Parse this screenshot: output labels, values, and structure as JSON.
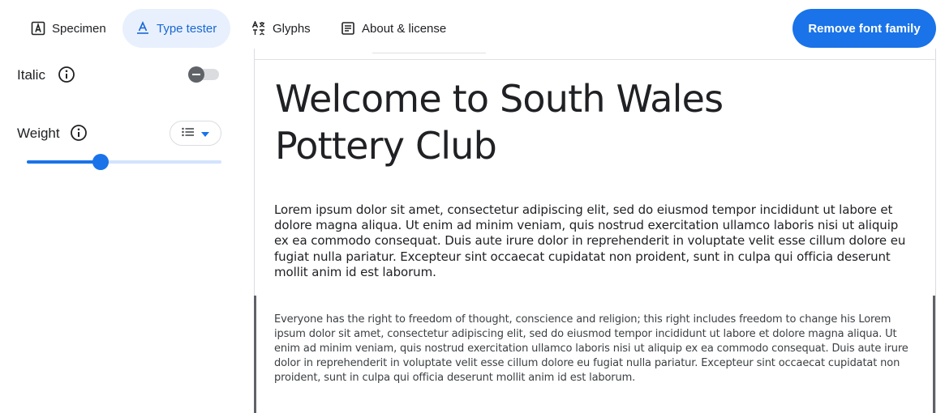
{
  "tabs": [
    {
      "label": "Specimen",
      "icon": "specimen-icon",
      "active": false
    },
    {
      "label": "Type tester",
      "icon": "type-tester-icon",
      "active": true
    },
    {
      "label": "Glyphs",
      "icon": "glyphs-icon",
      "active": false
    },
    {
      "label": "About & license",
      "icon": "article-icon",
      "active": false
    }
  ],
  "remove_button": "Remove font family",
  "controls": {
    "italic_label": "Italic",
    "italic_on": false,
    "weight_label": "Weight",
    "weight_fraction": 0.38
  },
  "preview": {
    "heading": "Welcome to South Wales Pottery Club",
    "paragraph": "Lorem ipsum dolor sit amet, consectetur adipiscing elit, sed do eiusmod tempor incididunt ut labore et dolore magna aliqua. Ut enim ad minim veniam, quis nostrud exercitation ullamco laboris nisi ut aliquip ex ea commodo consequat. Duis aute irure dolor in reprehenderit in voluptate velit esse cillum dolore eu fugiat nulla pariatur. Excepteur sint occaecat cupidatat non proident, sunt in culpa qui officia deserunt mollit anim id est laborum.",
    "small_text": "Everyone has the right to freedom of thought, conscience and religion; this right includes freedom to change his Lorem ipsum dolor sit amet, consectetur adipiscing elit, sed do eiusmod tempor incididunt ut labore et dolore magna aliqua. Ut enim ad minim veniam, quis nostrud exercitation ullamco laboris nisi ut aliquip ex ea commodo consequat. Duis aute irure dolor in reprehenderit in voluptate velit esse cillum dolore eu fugiat nulla pariatur. Excepteur sint occaecat cupidatat non proident, sunt in culpa qui officia deserunt mollit anim id est laborum."
  },
  "colors": {
    "accent": "#1a73e8",
    "active_tab_bg": "#e8f0fe",
    "active_tab_text": "#1967d2"
  }
}
